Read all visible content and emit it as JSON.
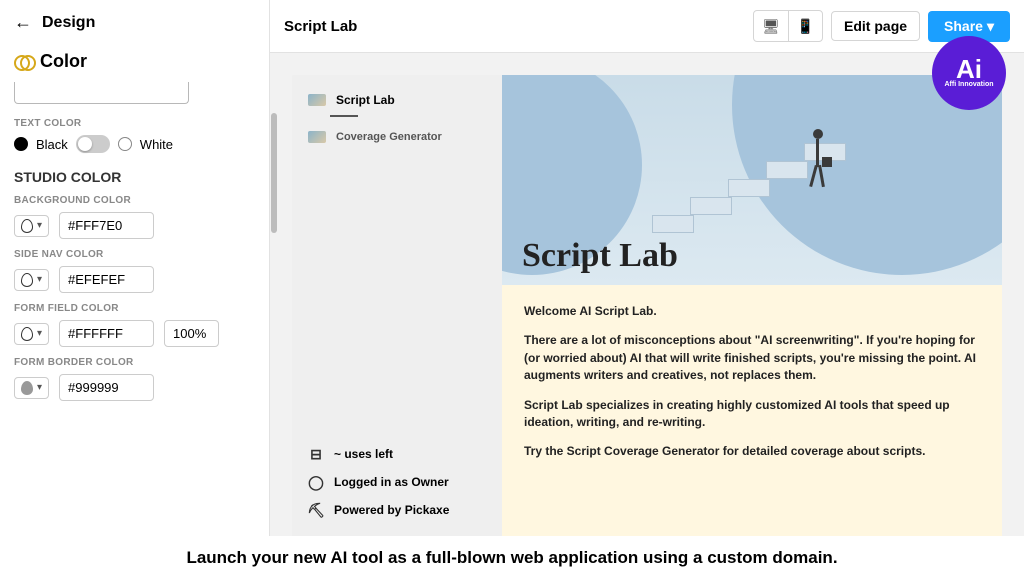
{
  "design": {
    "back_label": "Design",
    "color_section": "Color",
    "text_color_label": "TEXT COLOR",
    "black_label": "Black",
    "white_label": "White",
    "studio_heading": "STUDIO COLOR",
    "bg_label": "BACKGROUND COLOR",
    "bg_hex": "#FFF7E0",
    "sidenav_label": "SIDE NAV COLOR",
    "sidenav_hex": "#EFEFEF",
    "formfield_label": "FORM FIELD COLOR",
    "formfield_hex": "#FFFFFF",
    "formfield_opacity": "100%",
    "formborder_label": "FORM BORDER COLOR",
    "formborder_hex": "#999999"
  },
  "topbar": {
    "title": "Script Lab",
    "edit_label": "Edit page",
    "share_label": "Share"
  },
  "nav": {
    "item1": "Script Lab",
    "item2": "Coverage Generator",
    "uses_left": "~ uses left",
    "logged_in": "Logged in as Owner",
    "powered": "Powered by Pickaxe"
  },
  "content": {
    "hero_title": "Script Lab",
    "p1": "Welcome AI Script Lab.",
    "p2": "There are a lot of misconceptions about \"AI screenwriting\". If you're hoping for (or worried about) AI that will write finished scripts, you're missing the point. AI augments writers and creatives, not replaces them.",
    "p3": "Script Lab specializes in creating highly customized AI tools that speed up ideation, writing, and re-writing.",
    "p4": "Try the Script Coverage Generator for detailed coverage about scripts."
  },
  "badge": {
    "big": "Ai",
    "small": "Affi Innovation"
  },
  "caption": "Launch your new AI tool as a full-blown web application using a custom domain."
}
